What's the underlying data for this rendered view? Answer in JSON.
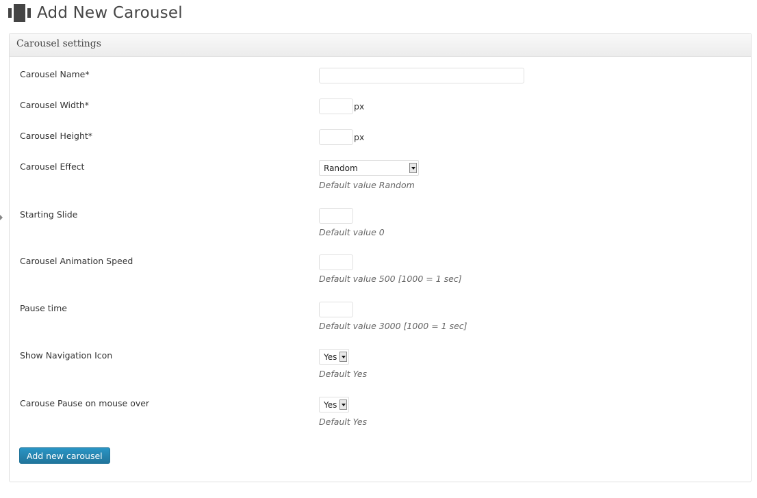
{
  "page": {
    "title": "Add New Carousel",
    "icon": "carousel-icon"
  },
  "box": {
    "title": "Carousel settings"
  },
  "fields": {
    "name": {
      "label": "Carousel Name*",
      "value": ""
    },
    "width": {
      "label": "Carousel Width*",
      "value": "",
      "unit": "px"
    },
    "height": {
      "label": "Carousel Height*",
      "value": "",
      "unit": "px"
    },
    "effect": {
      "label": "Carousel Effect",
      "selected": "Random",
      "hint": "Default value Random"
    },
    "starting_slide": {
      "label": "Starting Slide",
      "value": "",
      "hint": "Default value 0"
    },
    "animation_speed": {
      "label": "Carousel Animation Speed",
      "value": "",
      "hint": "Default value 500 [1000 = 1 sec]"
    },
    "pause_time": {
      "label": "Pause time",
      "value": "",
      "hint": "Default value 3000 [1000 = 1 sec]"
    },
    "show_nav": {
      "label": "Show Navigation Icon",
      "selected": "Yes",
      "hint": "Default Yes"
    },
    "pause_hover": {
      "label": "Carouse Pause on mouse over",
      "selected": "Yes",
      "hint": "Default Yes"
    }
  },
  "actions": {
    "submit_label": "Add new carousel"
  },
  "colors": {
    "primary_button": "#21759b",
    "border": "#dfdfdf",
    "hint_text": "#666666"
  }
}
